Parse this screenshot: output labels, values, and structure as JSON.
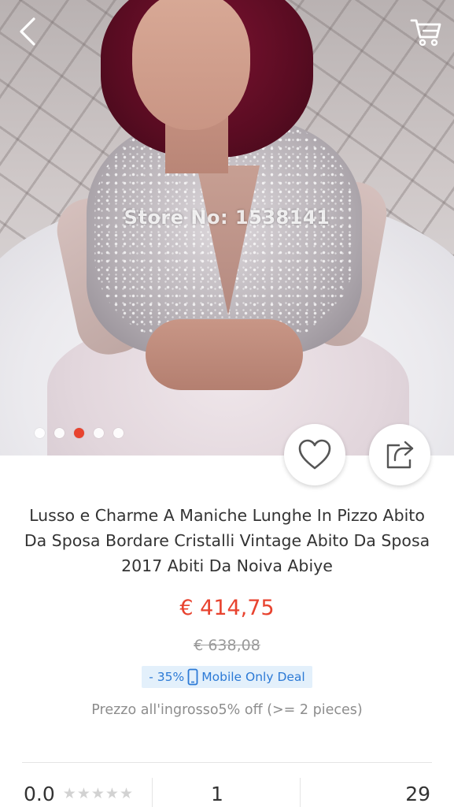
{
  "header": {
    "back_icon": "chevron-left-icon",
    "cart_icon": "shopping-cart-icon"
  },
  "gallery": {
    "watermark": "Store No: 1538141",
    "image_count": 5,
    "active_index": 2,
    "accent_color": "#e8432f"
  },
  "actions": {
    "wishlist_icon": "heart-outline-icon",
    "share_icon": "share-icon"
  },
  "product": {
    "title": "Lusso e Charme A Maniche Lunghe In Pizzo Abito Da Sposa Bordare Cristalli Vintage Abito Da Sposa 2017 Abiti Da Noiva Abiye",
    "price": "€ 414,75",
    "original_price": "€ 638,08",
    "deal_discount": "- 35%",
    "deal_label": "Mobile Only Deal",
    "wholesale_text": "Prezzo all'ingrosso5% off (>= 2 pieces)",
    "price_color": "#e8432f",
    "deal_color": "#2c7ad6"
  },
  "stats": {
    "rating": "0.0",
    "stars_filled": 0,
    "stars_total": 5,
    "orders": "1",
    "wishlist_count": "29"
  }
}
